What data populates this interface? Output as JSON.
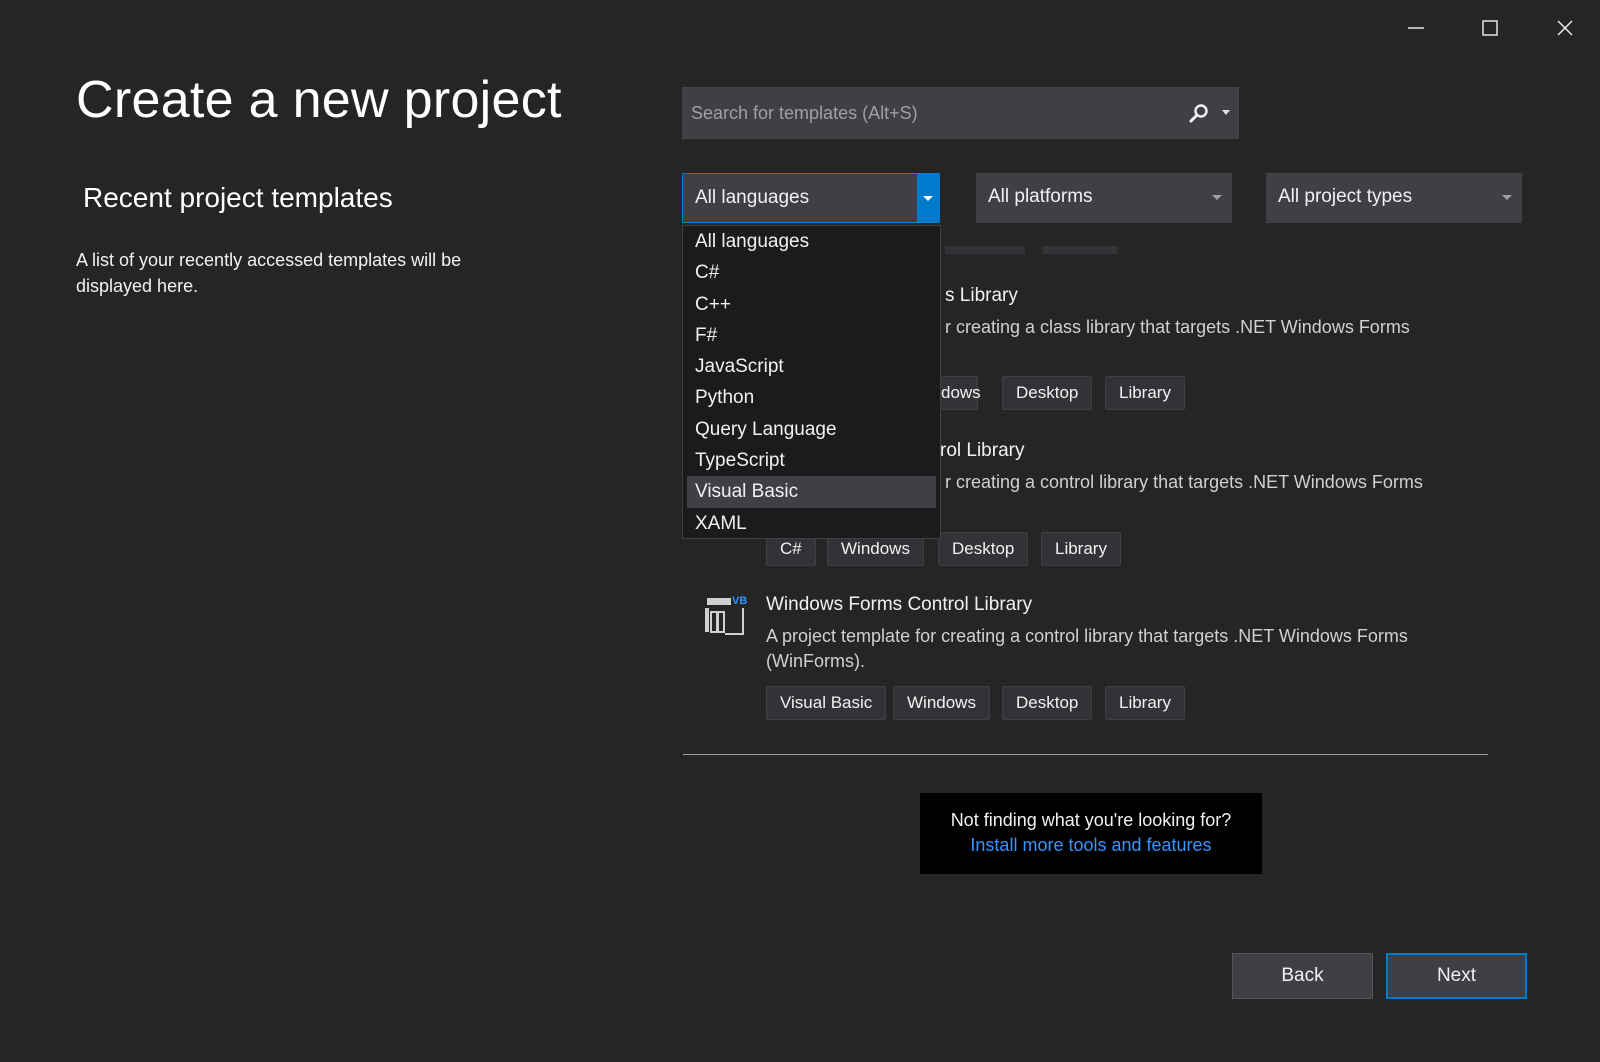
{
  "window": {
    "controls": [
      "minimize-icon",
      "maximize-icon",
      "close-icon"
    ]
  },
  "page": {
    "title": "Create a new project"
  },
  "recent": {
    "heading": "Recent project templates",
    "description": "A list of your recently accessed templates will be displayed here."
  },
  "search": {
    "placeholder": "Search for templates (Alt+S)",
    "value": ""
  },
  "filters": {
    "language": "All languages",
    "platform": "All platforms",
    "project_type": "All project types"
  },
  "language_dropdown": {
    "options": [
      "All languages",
      "C#",
      "C++",
      "F#",
      "JavaScript",
      "Python",
      "Query Language",
      "TypeScript",
      "Visual Basic",
      "XAML"
    ],
    "highlighted": "Visual Basic"
  },
  "templates": [
    {
      "title_visible": "s Library",
      "desc_line1": "r creating a class library that targets .NET Windows Forms",
      "tags_visible": [
        "dows",
        "Desktop",
        "Library"
      ]
    },
    {
      "title_visible": "rol Library",
      "desc_line1": "r creating a control library that targets .NET Windows Forms",
      "tags": [
        "C#",
        "Windows",
        "Desktop",
        "Library"
      ]
    },
    {
      "title": "Windows Forms Control Library",
      "icon_badge": "VB",
      "desc_line1": "A project template for creating a control library that targets .NET Windows Forms",
      "desc_line2": "(WinForms).",
      "tags": [
        "Visual Basic",
        "Windows",
        "Desktop",
        "Library"
      ]
    }
  ],
  "not_finding": {
    "question": "Not finding what you're looking for?",
    "link": "Install more tools and features"
  },
  "buttons": {
    "back": "Back",
    "next": "Next"
  },
  "colors": {
    "background": "#252526",
    "accent": "#007acc",
    "link": "#3794ff"
  }
}
